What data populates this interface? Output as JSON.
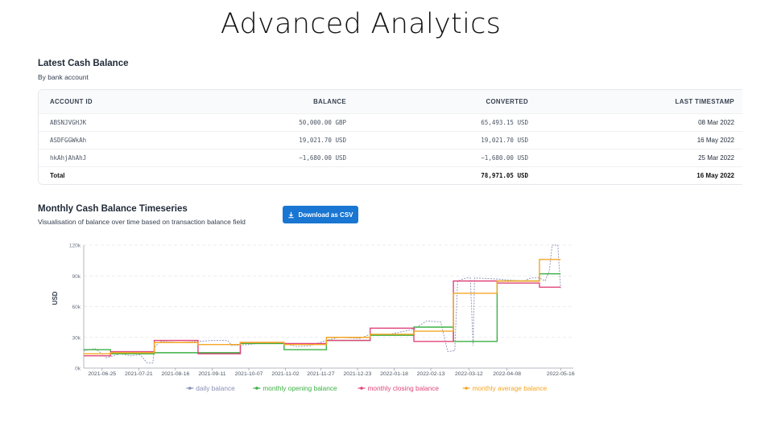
{
  "page_title": "Advanced Analytics",
  "cash_balance": {
    "title": "Latest Cash Balance",
    "subtitle": "By bank account",
    "columns": [
      "ACCOUNT ID",
      "BALANCE",
      "CONVERTED",
      "LAST TIMESTAMP"
    ],
    "rows": [
      [
        "ABSNJVGHJK",
        "50,000.00 GBP",
        "65,493.15 USD",
        "08 Mar 2022"
      ],
      [
        "ASDFGGWkAh",
        "19,021.70 USD",
        "19,021.70 USD",
        "16 May 2022"
      ],
      [
        "hkAhjAhAhJ",
        "−1,680.00 USD",
        "−1,680.00 USD",
        "25 Mar 2022"
      ]
    ],
    "total": [
      "Total",
      "",
      "78,971.05 USD",
      "16 May 2022"
    ]
  },
  "timeseries": {
    "title": "Monthly Cash Balance Timeseries",
    "subtitle": "Visualisation of balance over time based on transaction balance field",
    "download_label": "Download as CSV",
    "download_icon": "download-icon"
  },
  "chart_data": {
    "type": "line",
    "ylabel": "USD",
    "ylim": [
      0,
      120000
    ],
    "yticks": [
      "0k",
      "30k",
      "60k",
      "90k",
      "120k"
    ],
    "x_ticks": [
      "2021-06-25",
      "2021-07-21",
      "2021-08-16",
      "2021-09-11",
      "2021-10-07",
      "2021-11-02",
      "2021-11-27",
      "2021-12-23",
      "2022-01-18",
      "2022-02-13",
      "2022-03-12",
      "2022-04-08",
      "2022-05-16"
    ],
    "x_start": "2021-06-12",
    "x_end": "2022-05-25",
    "grid": "horizontal dashed",
    "legend_position": "bottom",
    "colors": {
      "daily": "#8a8fb5",
      "opening": "#3cb043",
      "closing": "#e0457b",
      "average": "#f5a623"
    },
    "series": [
      {
        "name": "daily balance",
        "key": "daily",
        "dashed": true,
        "points": [
          [
            "2021-06-12",
            17000
          ],
          [
            "2021-06-20",
            19000
          ],
          [
            "2021-06-24",
            15000
          ],
          [
            "2021-06-28",
            10000
          ],
          [
            "2021-07-08",
            14000
          ],
          [
            "2021-07-15",
            12000
          ],
          [
            "2021-07-22",
            13000
          ],
          [
            "2021-07-27",
            5000
          ],
          [
            "2021-07-31",
            5000
          ],
          [
            "2021-08-01",
            20000
          ],
          [
            "2021-08-05",
            26000
          ],
          [
            "2021-08-20",
            25000
          ],
          [
            "2021-09-01",
            26000
          ],
          [
            "2021-09-12",
            27000
          ],
          [
            "2021-09-22",
            27000
          ],
          [
            "2021-09-25",
            22000
          ],
          [
            "2021-10-07",
            23000
          ],
          [
            "2021-10-20",
            25000
          ],
          [
            "2021-11-01",
            24000
          ],
          [
            "2021-11-10",
            21000
          ],
          [
            "2021-11-20",
            22000
          ],
          [
            "2021-12-01",
            27000
          ],
          [
            "2021-12-10",
            30000
          ],
          [
            "2021-12-25",
            29000
          ],
          [
            "2022-01-01",
            33000
          ],
          [
            "2022-01-15",
            33000
          ],
          [
            "2022-02-01",
            38000
          ],
          [
            "2022-02-10",
            46000
          ],
          [
            "2022-02-20",
            45000
          ],
          [
            "2022-02-25",
            16000
          ],
          [
            "2022-03-02",
            17000
          ],
          [
            "2022-03-04",
            85000
          ],
          [
            "2022-03-10",
            88000
          ],
          [
            "2022-03-13",
            88000
          ],
          [
            "2022-03-15",
            22000
          ],
          [
            "2022-03-16",
            88000
          ],
          [
            "2022-04-01",
            87000
          ],
          [
            "2022-04-08",
            86000
          ],
          [
            "2022-04-20",
            85000
          ],
          [
            "2022-04-25",
            88000
          ],
          [
            "2022-05-01",
            88000
          ],
          [
            "2022-05-05",
            85000
          ],
          [
            "2022-05-08",
            95000
          ],
          [
            "2022-05-10",
            120000
          ],
          [
            "2022-05-14",
            120000
          ],
          [
            "2022-05-16",
            78000
          ]
        ]
      },
      {
        "name": "monthly opening balance",
        "key": "opening",
        "steps": [
          [
            "2021-06-12",
            18000
          ],
          [
            "2021-07-01",
            14000
          ],
          [
            "2021-08-01",
            15000
          ],
          [
            "2021-09-01",
            15000
          ],
          [
            "2021-10-01",
            24000
          ],
          [
            "2021-11-01",
            18000
          ],
          [
            "2021-12-01",
            27000
          ],
          [
            "2022-01-01",
            32000
          ],
          [
            "2022-02-01",
            40000
          ],
          [
            "2022-03-01",
            26000
          ],
          [
            "2022-04-01",
            85000
          ],
          [
            "2022-05-01",
            92000
          ],
          [
            "2022-05-16",
            92000
          ]
        ]
      },
      {
        "name": "monthly closing balance",
        "key": "closing",
        "steps": [
          [
            "2021-06-12",
            12000
          ],
          [
            "2021-07-01",
            16000
          ],
          [
            "2021-08-01",
            27000
          ],
          [
            "2021-09-01",
            14000
          ],
          [
            "2021-10-01",
            25000
          ],
          [
            "2021-11-01",
            24000
          ],
          [
            "2021-12-01",
            27000
          ],
          [
            "2022-01-01",
            39000
          ],
          [
            "2022-02-01",
            26000
          ],
          [
            "2022-03-01",
            85000
          ],
          [
            "2022-04-01",
            83000
          ],
          [
            "2022-05-01",
            79000
          ],
          [
            "2022-05-16",
            79000
          ]
        ]
      },
      {
        "name": "monthly average balance",
        "key": "average",
        "steps": [
          [
            "2021-06-12",
            14000
          ],
          [
            "2021-07-01",
            15000
          ],
          [
            "2021-08-01",
            25000
          ],
          [
            "2021-09-01",
            23000
          ],
          [
            "2021-10-01",
            25000
          ],
          [
            "2021-11-01",
            23000
          ],
          [
            "2021-12-01",
            30000
          ],
          [
            "2022-01-01",
            33000
          ],
          [
            "2022-02-01",
            36000
          ],
          [
            "2022-03-01",
            73000
          ],
          [
            "2022-04-01",
            85000
          ],
          [
            "2022-05-01",
            106000
          ],
          [
            "2022-05-16",
            106000
          ]
        ]
      }
    ]
  }
}
